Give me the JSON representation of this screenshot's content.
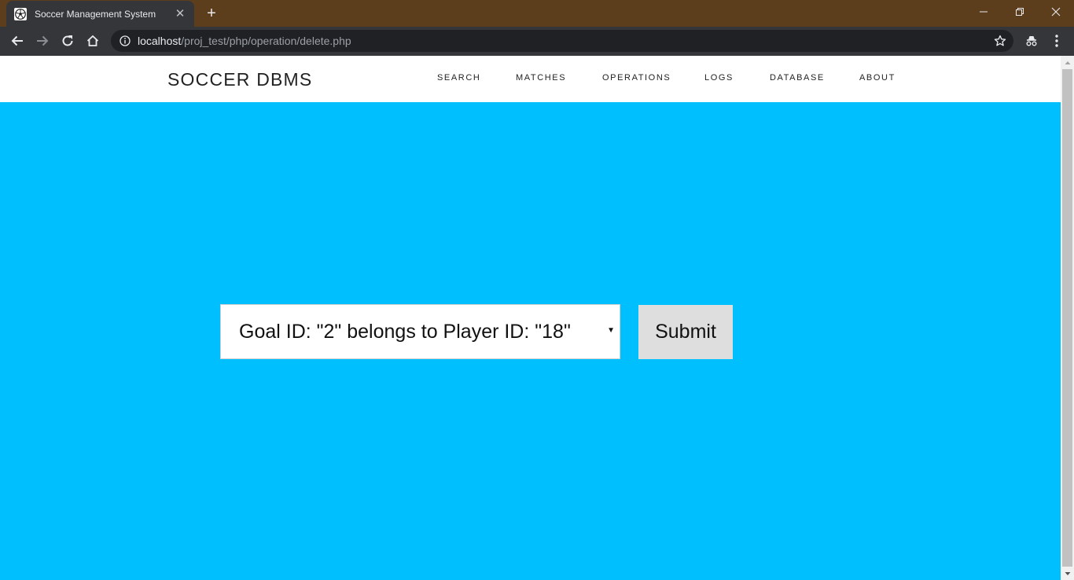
{
  "browser": {
    "tab_title": "Soccer Management System",
    "new_tab_icon": "+",
    "url_host": "localhost",
    "url_path": "/proj_test/php/operation/delete.php",
    "colors": {
      "titlebar": "#5c3d1c",
      "toolbar": "#35363a",
      "omnibox": "#202124"
    }
  },
  "site": {
    "brand": "SOCCER DBMS",
    "nav": [
      "SEARCH",
      "MATCHES",
      "OPERATIONS",
      "LOGS",
      "DATABASE",
      "ABOUT"
    ],
    "background_color": "#00bfff"
  },
  "form": {
    "select_value": "Goal ID: \"2\" belongs to Player ID: \"18\"",
    "submit_label": "Submit"
  }
}
